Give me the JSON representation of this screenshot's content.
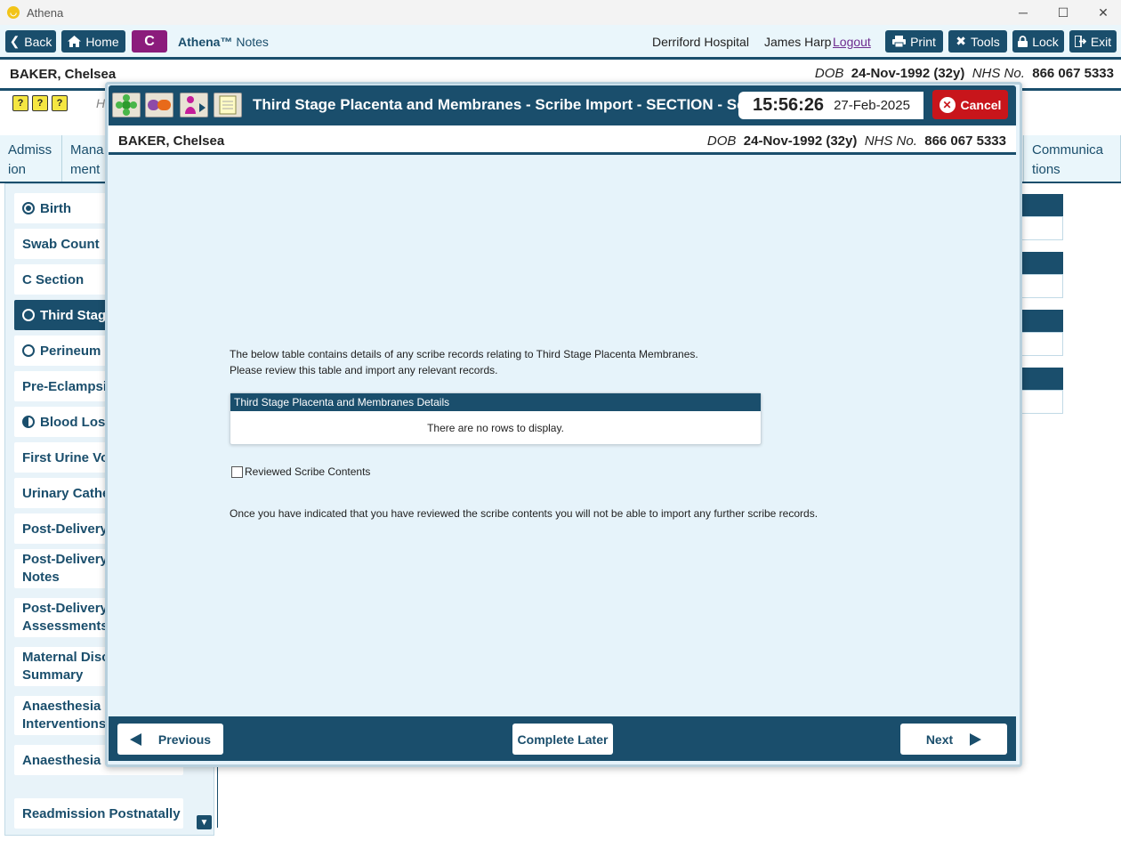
{
  "window": {
    "title": "Athena"
  },
  "toolbar": {
    "back_label": "Back",
    "home_label": "Home",
    "c_label": "C",
    "app_brand": "Athena™",
    "app_module": "Notes",
    "hospital": "Derriford Hospital",
    "user": "James Harp",
    "logout_label": "Logout",
    "print_label": "Print",
    "tools_label": "Tools",
    "lock_label": "Lock",
    "exit_label": "Exit"
  },
  "patient": {
    "name": "BAKER, Chelsea",
    "dob_label": "DOB",
    "dob": "24-Nov-1992 (32y)",
    "nhs_label": "NHS No.",
    "nhs": "866 067 5333"
  },
  "background": {
    "h_text": "H",
    "tabs": [
      {
        "line1": "Admiss",
        "line2": "ion"
      },
      {
        "line1": "Mana",
        "line2": "ment"
      },
      {
        "line1": "Communica",
        "line2": "tions"
      }
    ],
    "sidebar": [
      {
        "label": "Birth",
        "status": "filled"
      },
      {
        "label": "Swab Count",
        "status": "none"
      },
      {
        "label": "C Section",
        "status": "none"
      },
      {
        "label": "Third Stage",
        "status": "empty",
        "active": true
      },
      {
        "label": "Perineum",
        "status": "empty"
      },
      {
        "label": "Pre-Eclampsia",
        "status": "none"
      },
      {
        "label": "Blood Loss",
        "status": "half"
      },
      {
        "label": "First Urine Voi",
        "status": "none"
      },
      {
        "label": "Urinary Cathe",
        "status": "none"
      },
      {
        "label": "Post-Delivery",
        "status": "none"
      },
      {
        "label": "Post-Delivery Notes",
        "status": "none"
      },
      {
        "label": "Post-Delivery Assessments",
        "status": "none"
      },
      {
        "label": "Maternal Disc Summary",
        "status": "none"
      },
      {
        "label": "Anaesthesia Interventions",
        "status": "none"
      },
      {
        "label": "Anaesthesia Fo",
        "status": "none"
      },
      {
        "label": "Readmission Postnatally",
        "status": "none"
      }
    ]
  },
  "modal": {
    "title": "Third Stage Placenta and Membranes - Scribe Import - SECTION - Scrib",
    "time": "15:56:26",
    "date": "27-Feb-2025",
    "cancel_label": "Cancel",
    "intro_line1": "The below table contains details of any scribe records relating to Third Stage Placenta Membranes.",
    "intro_line2": "Please review this table and import any relevant records.",
    "grid_title": "Third Stage Placenta and Membranes Details",
    "grid_empty": "There are no rows to display.",
    "checkbox_label": "Reviewed Scribe Contents",
    "checkbox_checked": false,
    "note": "Once you have indicated that you have reviewed the scribe contents you will not be able to import any further scribe records.",
    "prev_label": "Previous",
    "complete_later_label": "Complete Later",
    "next_label": "Next"
  },
  "colors": {
    "primary": "#1a4e6c",
    "accent_purple": "#8b1c7c",
    "cancel_red": "#c8151b",
    "panel_bg": "#e6f3fa"
  }
}
